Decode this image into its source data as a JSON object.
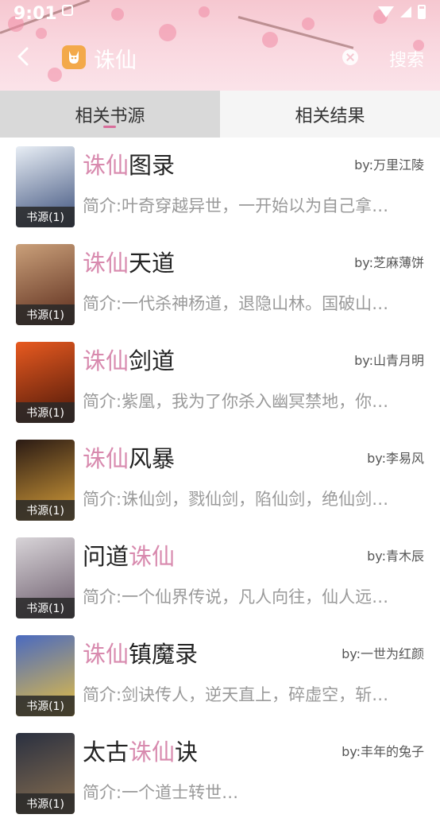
{
  "status_bar": {
    "time": "9:01"
  },
  "header": {
    "search_query": "诛仙",
    "search_button": "搜索",
    "icons": [
      "back-icon",
      "app-logo-icon",
      "clear-icon"
    ]
  },
  "tabs": [
    {
      "label": "相关书源",
      "active": true
    },
    {
      "label": "相关结果",
      "active": false
    }
  ],
  "results": [
    {
      "title_before": "",
      "title_hl": "诛仙",
      "title_after": "图录",
      "author": "by:万里江陵",
      "intro": "简介:叶奇穿越异世，一开始以为自己拿…",
      "badge": "书源(1)",
      "cover_colors": [
        "#e8eef5",
        "#3a4e7a"
      ]
    },
    {
      "title_before": "",
      "title_hl": "诛仙",
      "title_after": "天道",
      "author": "by:芝麻薄饼",
      "intro": "简介:一代杀神杨道，退隐山林。国破山…",
      "badge": "书源(1)",
      "cover_colors": [
        "#caa07a",
        "#5a2a1a"
      ]
    },
    {
      "title_before": "",
      "title_hl": "诛仙",
      "title_after": "剑道",
      "author": "by:山青月明",
      "intro": "简介:紫凰，我为了你杀入幽冥禁地，你…",
      "badge": "书源(1)",
      "cover_colors": [
        "#e85a20",
        "#4a1608"
      ]
    },
    {
      "title_before": "",
      "title_hl": "诛仙",
      "title_after": "风暴",
      "author": "by:李易风",
      "intro": "简介:诛仙剑，戮仙剑，陷仙剑，绝仙剑…",
      "badge": "书源(1)",
      "cover_colors": [
        "#2a1a14",
        "#d8a03a"
      ]
    },
    {
      "title_before": "问道",
      "title_hl": "诛仙",
      "title_after": "",
      "author": "by:青木辰",
      "intro": "简介:一个仙界传说，凡人向往，仙人远…",
      "badge": "书源(1)",
      "cover_colors": [
        "#d8d4d8",
        "#6a5a6a"
      ]
    },
    {
      "title_before": "",
      "title_hl": "诛仙",
      "title_after": "镇魔录",
      "author": "by:一世为红颜",
      "intro": "简介:剑诀传人，逆天直上，碎虚空，斩…",
      "badge": "书源(1)",
      "cover_colors": [
        "#4a6ac0",
        "#e8c040"
      ]
    },
    {
      "title_before": "太古",
      "title_hl": "诛仙",
      "title_after": "诀",
      "author": "by:丰年的兔子",
      "intro": "简介:一个道士转世…",
      "badge": "书源(1)",
      "cover_colors": [
        "#2a3040",
        "#8a7050"
      ]
    }
  ]
}
